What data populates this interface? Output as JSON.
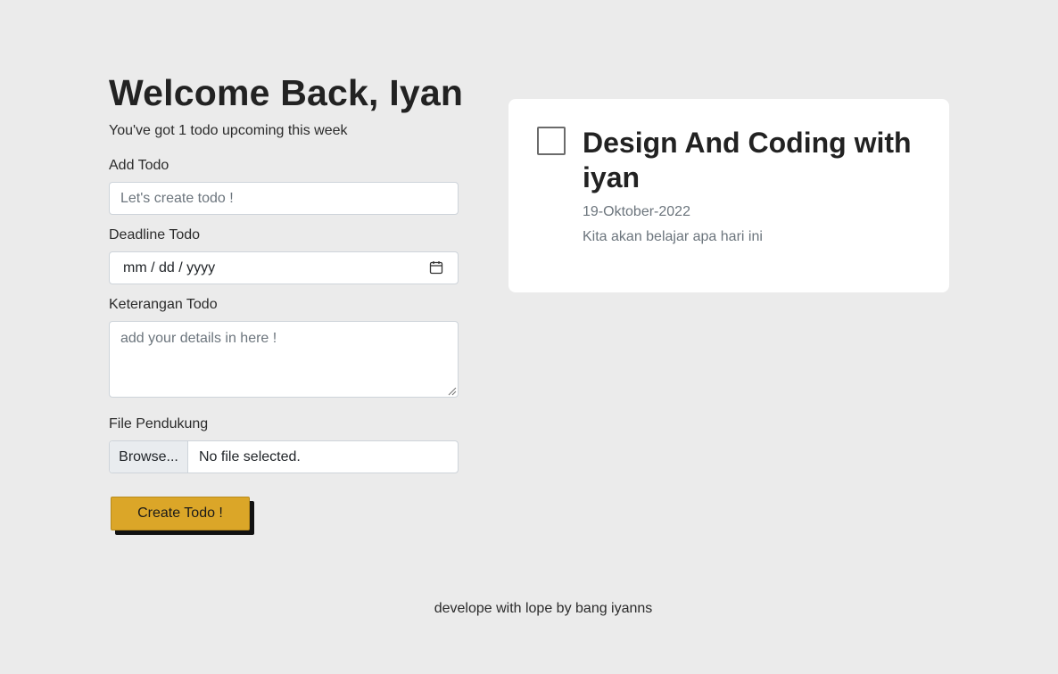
{
  "header": {
    "title": "Welcome Back, Iyan",
    "subtitle": "You've got 1 todo upcoming this week"
  },
  "form": {
    "add_todo": {
      "label": "Add Todo",
      "placeholder": "Let's create todo !",
      "value": ""
    },
    "deadline": {
      "label": "Deadline Todo",
      "value_display": "mm / dd / yyyy",
      "icon": "calendar-icon"
    },
    "keterangan": {
      "label": "Keterangan Todo",
      "placeholder": "add your details in here !",
      "value": ""
    },
    "file": {
      "label": "File Pendukung",
      "browse_label": "Browse...",
      "status": "No file selected."
    },
    "submit_label": "Create Todo !"
  },
  "todos": [
    {
      "title": "Design And Coding with iyan",
      "date": "19-Oktober-2022",
      "description": "Kita akan belajar apa hari ini",
      "checked": false
    }
  ],
  "footer": {
    "text": "develope with lope by bang iyanns"
  },
  "colors": {
    "background": "#ebebeb",
    "accent_button": "#dba628",
    "card": "#ffffff"
  }
}
